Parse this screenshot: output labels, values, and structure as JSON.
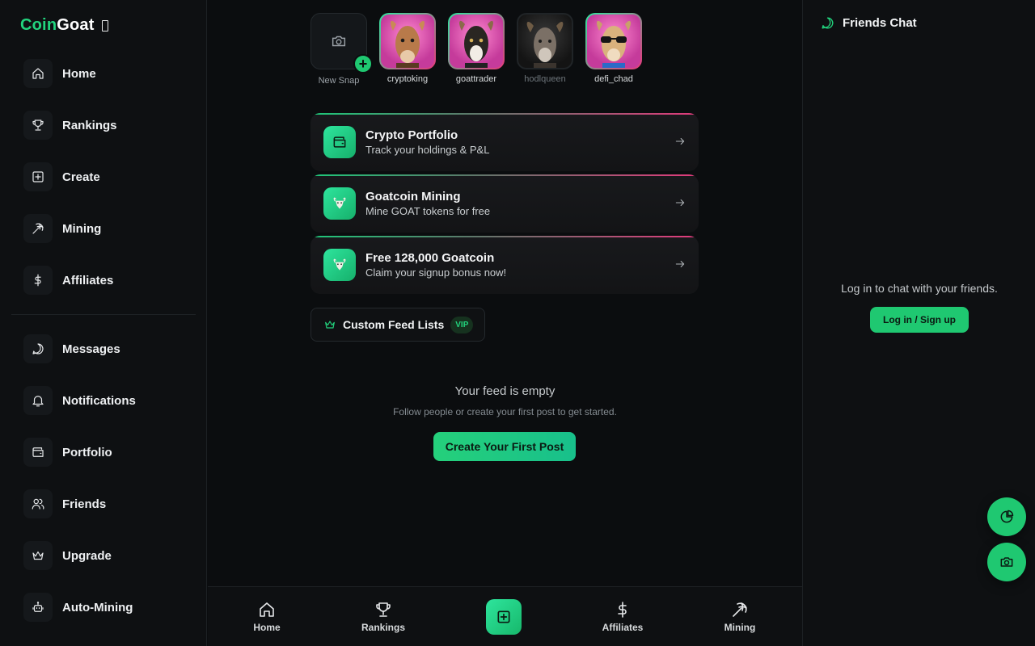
{
  "brand": {
    "part1": "Coin",
    "part2": "Goat",
    "accent": "#22d47e"
  },
  "sidebar": {
    "items": [
      {
        "label": "Home",
        "icon": "home-icon"
      },
      {
        "label": "Rankings",
        "icon": "trophy-icon"
      },
      {
        "label": "Create",
        "icon": "plus-square-icon"
      },
      {
        "label": "Mining",
        "icon": "pickaxe-icon"
      },
      {
        "label": "Affiliates",
        "icon": "dollar-icon"
      },
      {
        "label": "Messages",
        "icon": "chat-bubble-icon"
      },
      {
        "label": "Notifications",
        "icon": "bell-icon"
      },
      {
        "label": "Portfolio",
        "icon": "wallet-icon"
      },
      {
        "label": "Friends",
        "icon": "users-icon"
      },
      {
        "label": "Upgrade",
        "icon": "crown-icon"
      },
      {
        "label": "Auto-Mining",
        "icon": "robot-icon"
      }
    ]
  },
  "snaps": {
    "new_label": "New Snap",
    "users": [
      {
        "name": "cryptoking",
        "seen": false
      },
      {
        "name": "goattrader",
        "seen": false
      },
      {
        "name": "hodlqueen",
        "seen": true
      },
      {
        "name": "defi_chad",
        "seen": false
      }
    ]
  },
  "promos": [
    {
      "title": "Crypto Portfolio",
      "subtitle": "Track your holdings & P&L",
      "icon": "wallet-icon"
    },
    {
      "title": "Goatcoin Mining",
      "subtitle": "Mine GOAT tokens for free",
      "icon": "goat-icon"
    },
    {
      "title": "Free 128,000 Goatcoin",
      "subtitle": "Claim your signup bonus now!",
      "icon": "goat-icon"
    }
  ],
  "custom_feed": {
    "label": "Custom Feed Lists",
    "badge": "VIP"
  },
  "feed": {
    "empty_title": "Your feed is empty",
    "empty_subtitle": "Follow people or create your first post to get started.",
    "cta": "Create Your First Post"
  },
  "bottom_nav": {
    "items": [
      {
        "label": "Home",
        "icon": "home-icon"
      },
      {
        "label": "Rankings",
        "icon": "trophy-icon"
      },
      {
        "label": "Affiliates",
        "icon": "dollar-icon"
      },
      {
        "label": "Mining",
        "icon": "pickaxe-icon"
      }
    ],
    "create_icon": "plus-square-icon"
  },
  "chat": {
    "title": "Friends Chat",
    "message": "Log in to chat with your friends.",
    "login_label": "Log in / Sign up"
  },
  "fabs": [
    {
      "icon": "pie-chart-icon"
    },
    {
      "icon": "camera-icon"
    }
  ]
}
